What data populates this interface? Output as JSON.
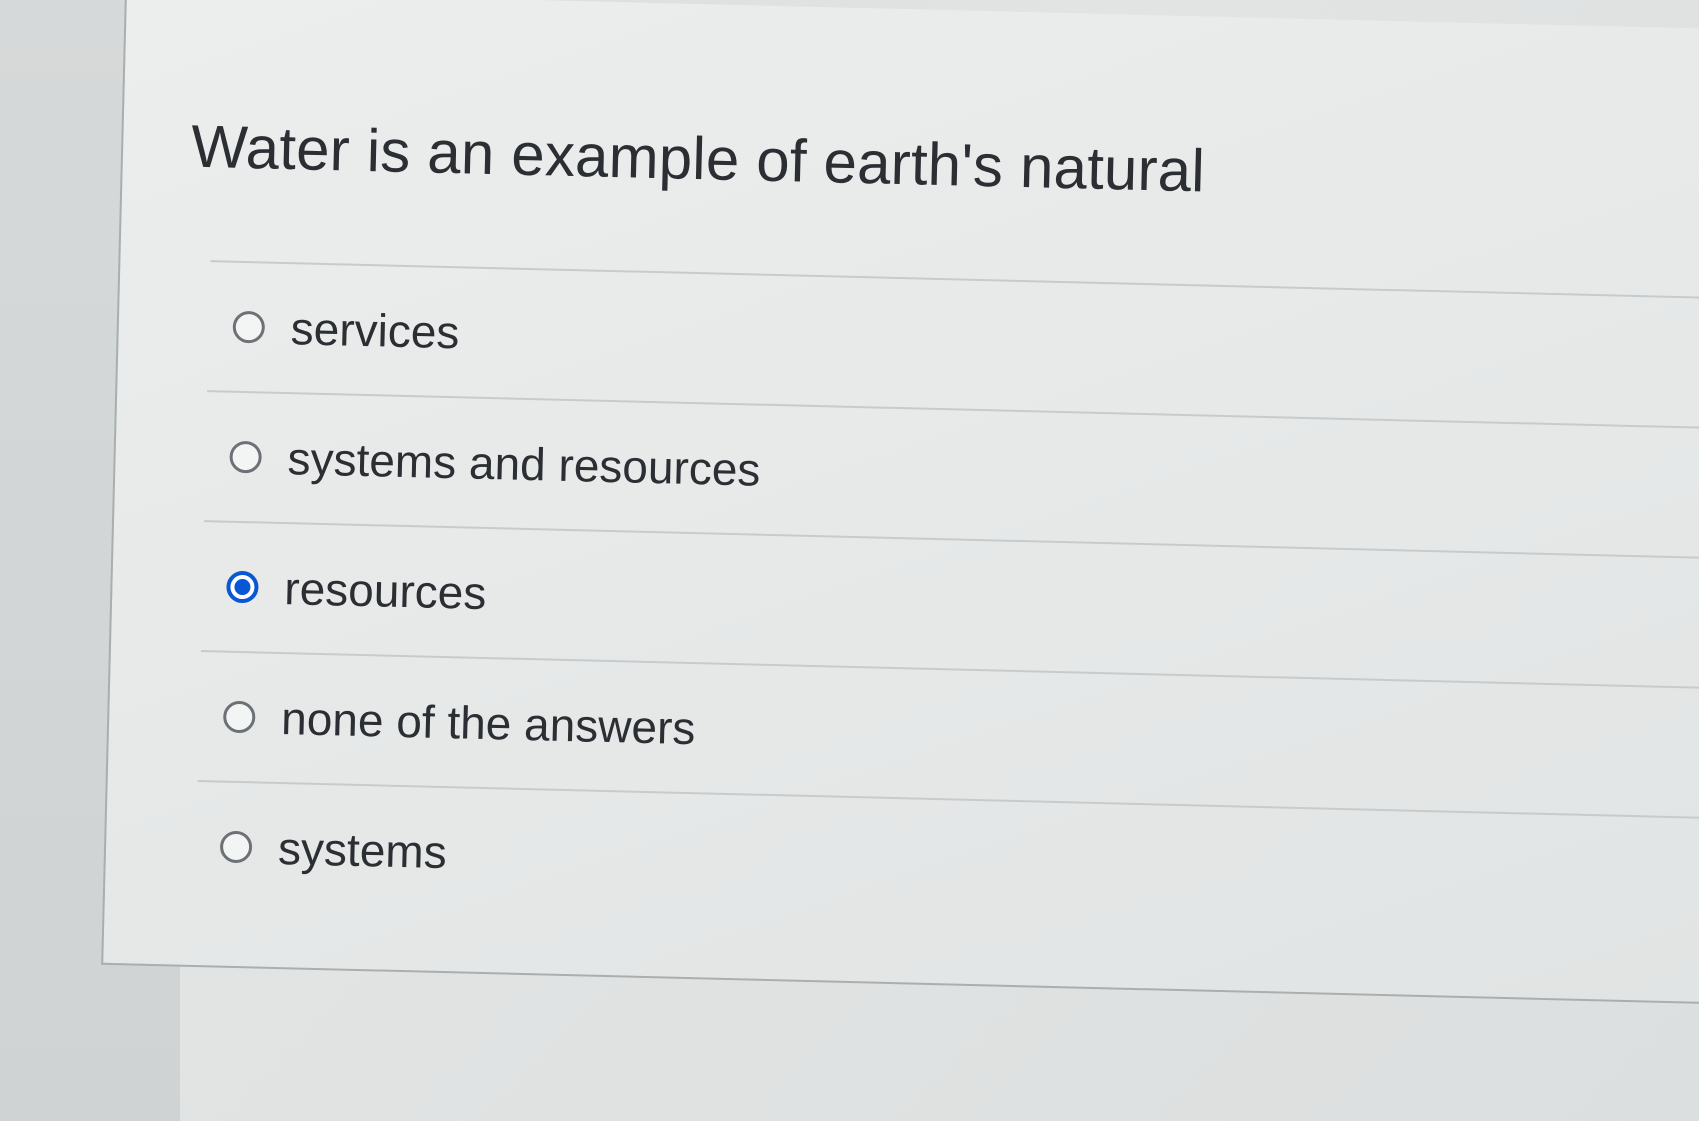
{
  "question": {
    "text": "Water is an example of earth's natural"
  },
  "answers": [
    {
      "label": "services",
      "selected": false
    },
    {
      "label": "systems and resources",
      "selected": false
    },
    {
      "label": "resources",
      "selected": true
    },
    {
      "label": "none of the answers",
      "selected": false
    },
    {
      "label": "systems",
      "selected": false
    }
  ],
  "colors": {
    "selected_radio": "#0a57d6",
    "text": "#2b2f33",
    "divider": "#c6cbcd"
  }
}
